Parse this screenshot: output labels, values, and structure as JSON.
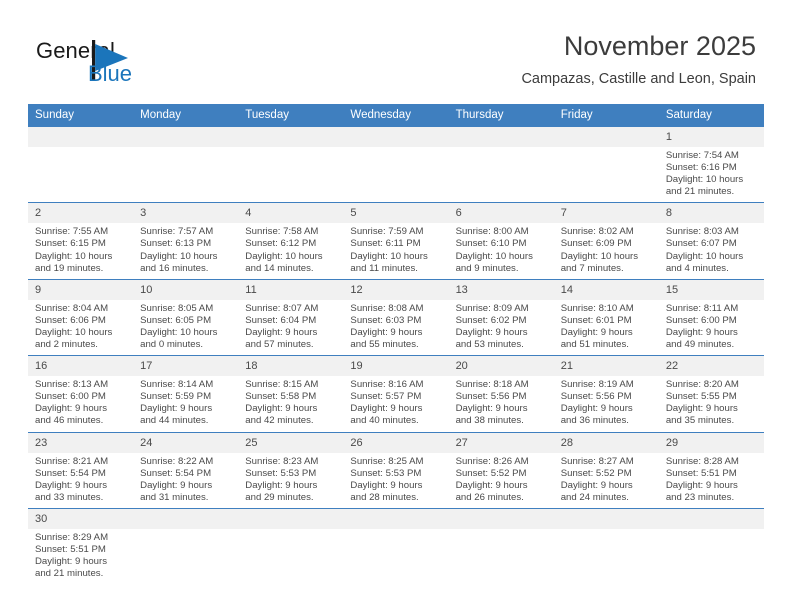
{
  "brand": {
    "name_part1": "General",
    "name_part2": "Blue",
    "flag_icon": "triangle-flag-icon"
  },
  "header": {
    "title": "November 2025",
    "location": "Campazas, Castille and Leon, Spain"
  },
  "colors": {
    "header_blue": "#3f7fbf",
    "brand_blue": "#1b75bb",
    "daynum_band": "#f1f1f1",
    "text": "#4a4a4a"
  },
  "weekdays": [
    "Sunday",
    "Monday",
    "Tuesday",
    "Wednesday",
    "Thursday",
    "Friday",
    "Saturday"
  ],
  "labels": {
    "sunrise": "Sunrise:",
    "sunset": "Sunset:",
    "daylight": "Daylight:"
  },
  "weeks": [
    [
      {
        "day": "",
        "empty": true
      },
      {
        "day": "",
        "empty": true
      },
      {
        "day": "",
        "empty": true
      },
      {
        "day": "",
        "empty": true
      },
      {
        "day": "",
        "empty": true
      },
      {
        "day": "",
        "empty": true
      },
      {
        "day": "1",
        "sunrise": "Sunrise: 7:54 AM",
        "sunset": "Sunset: 6:16 PM",
        "daylight1": "Daylight: 10 hours",
        "daylight2": "and 21 minutes."
      }
    ],
    [
      {
        "day": "2",
        "sunrise": "Sunrise: 7:55 AM",
        "sunset": "Sunset: 6:15 PM",
        "daylight1": "Daylight: 10 hours",
        "daylight2": "and 19 minutes."
      },
      {
        "day": "3",
        "sunrise": "Sunrise: 7:57 AM",
        "sunset": "Sunset: 6:13 PM",
        "daylight1": "Daylight: 10 hours",
        "daylight2": "and 16 minutes."
      },
      {
        "day": "4",
        "sunrise": "Sunrise: 7:58 AM",
        "sunset": "Sunset: 6:12 PM",
        "daylight1": "Daylight: 10 hours",
        "daylight2": "and 14 minutes."
      },
      {
        "day": "5",
        "sunrise": "Sunrise: 7:59 AM",
        "sunset": "Sunset: 6:11 PM",
        "daylight1": "Daylight: 10 hours",
        "daylight2": "and 11 minutes."
      },
      {
        "day": "6",
        "sunrise": "Sunrise: 8:00 AM",
        "sunset": "Sunset: 6:10 PM",
        "daylight1": "Daylight: 10 hours",
        "daylight2": "and 9 minutes."
      },
      {
        "day": "7",
        "sunrise": "Sunrise: 8:02 AM",
        "sunset": "Sunset: 6:09 PM",
        "daylight1": "Daylight: 10 hours",
        "daylight2": "and 7 minutes."
      },
      {
        "day": "8",
        "sunrise": "Sunrise: 8:03 AM",
        "sunset": "Sunset: 6:07 PM",
        "daylight1": "Daylight: 10 hours",
        "daylight2": "and 4 minutes."
      }
    ],
    [
      {
        "day": "9",
        "sunrise": "Sunrise: 8:04 AM",
        "sunset": "Sunset: 6:06 PM",
        "daylight1": "Daylight: 10 hours",
        "daylight2": "and 2 minutes."
      },
      {
        "day": "10",
        "sunrise": "Sunrise: 8:05 AM",
        "sunset": "Sunset: 6:05 PM",
        "daylight1": "Daylight: 10 hours",
        "daylight2": "and 0 minutes."
      },
      {
        "day": "11",
        "sunrise": "Sunrise: 8:07 AM",
        "sunset": "Sunset: 6:04 PM",
        "daylight1": "Daylight: 9 hours",
        "daylight2": "and 57 minutes."
      },
      {
        "day": "12",
        "sunrise": "Sunrise: 8:08 AM",
        "sunset": "Sunset: 6:03 PM",
        "daylight1": "Daylight: 9 hours",
        "daylight2": "and 55 minutes."
      },
      {
        "day": "13",
        "sunrise": "Sunrise: 8:09 AM",
        "sunset": "Sunset: 6:02 PM",
        "daylight1": "Daylight: 9 hours",
        "daylight2": "and 53 minutes."
      },
      {
        "day": "14",
        "sunrise": "Sunrise: 8:10 AM",
        "sunset": "Sunset: 6:01 PM",
        "daylight1": "Daylight: 9 hours",
        "daylight2": "and 51 minutes."
      },
      {
        "day": "15",
        "sunrise": "Sunrise: 8:11 AM",
        "sunset": "Sunset: 6:00 PM",
        "daylight1": "Daylight: 9 hours",
        "daylight2": "and 49 minutes."
      }
    ],
    [
      {
        "day": "16",
        "sunrise": "Sunrise: 8:13 AM",
        "sunset": "Sunset: 6:00 PM",
        "daylight1": "Daylight: 9 hours",
        "daylight2": "and 46 minutes."
      },
      {
        "day": "17",
        "sunrise": "Sunrise: 8:14 AM",
        "sunset": "Sunset: 5:59 PM",
        "daylight1": "Daylight: 9 hours",
        "daylight2": "and 44 minutes."
      },
      {
        "day": "18",
        "sunrise": "Sunrise: 8:15 AM",
        "sunset": "Sunset: 5:58 PM",
        "daylight1": "Daylight: 9 hours",
        "daylight2": "and 42 minutes."
      },
      {
        "day": "19",
        "sunrise": "Sunrise: 8:16 AM",
        "sunset": "Sunset: 5:57 PM",
        "daylight1": "Daylight: 9 hours",
        "daylight2": "and 40 minutes."
      },
      {
        "day": "20",
        "sunrise": "Sunrise: 8:18 AM",
        "sunset": "Sunset: 5:56 PM",
        "daylight1": "Daylight: 9 hours",
        "daylight2": "and 38 minutes."
      },
      {
        "day": "21",
        "sunrise": "Sunrise: 8:19 AM",
        "sunset": "Sunset: 5:56 PM",
        "daylight1": "Daylight: 9 hours",
        "daylight2": "and 36 minutes."
      },
      {
        "day": "22",
        "sunrise": "Sunrise: 8:20 AM",
        "sunset": "Sunset: 5:55 PM",
        "daylight1": "Daylight: 9 hours",
        "daylight2": "and 35 minutes."
      }
    ],
    [
      {
        "day": "23",
        "sunrise": "Sunrise: 8:21 AM",
        "sunset": "Sunset: 5:54 PM",
        "daylight1": "Daylight: 9 hours",
        "daylight2": "and 33 minutes."
      },
      {
        "day": "24",
        "sunrise": "Sunrise: 8:22 AM",
        "sunset": "Sunset: 5:54 PM",
        "daylight1": "Daylight: 9 hours",
        "daylight2": "and 31 minutes."
      },
      {
        "day": "25",
        "sunrise": "Sunrise: 8:23 AM",
        "sunset": "Sunset: 5:53 PM",
        "daylight1": "Daylight: 9 hours",
        "daylight2": "and 29 minutes."
      },
      {
        "day": "26",
        "sunrise": "Sunrise: 8:25 AM",
        "sunset": "Sunset: 5:53 PM",
        "daylight1": "Daylight: 9 hours",
        "daylight2": "and 28 minutes."
      },
      {
        "day": "27",
        "sunrise": "Sunrise: 8:26 AM",
        "sunset": "Sunset: 5:52 PM",
        "daylight1": "Daylight: 9 hours",
        "daylight2": "and 26 minutes."
      },
      {
        "day": "28",
        "sunrise": "Sunrise: 8:27 AM",
        "sunset": "Sunset: 5:52 PM",
        "daylight1": "Daylight: 9 hours",
        "daylight2": "and 24 minutes."
      },
      {
        "day": "29",
        "sunrise": "Sunrise: 8:28 AM",
        "sunset": "Sunset: 5:51 PM",
        "daylight1": "Daylight: 9 hours",
        "daylight2": "and 23 minutes."
      }
    ],
    [
      {
        "day": "30",
        "sunrise": "Sunrise: 8:29 AM",
        "sunset": "Sunset: 5:51 PM",
        "daylight1": "Daylight: 9 hours",
        "daylight2": "and 21 minutes."
      },
      {
        "day": "",
        "empty": true
      },
      {
        "day": "",
        "empty": true
      },
      {
        "day": "",
        "empty": true
      },
      {
        "day": "",
        "empty": true
      },
      {
        "day": "",
        "empty": true
      },
      {
        "day": "",
        "empty": true
      }
    ]
  ]
}
